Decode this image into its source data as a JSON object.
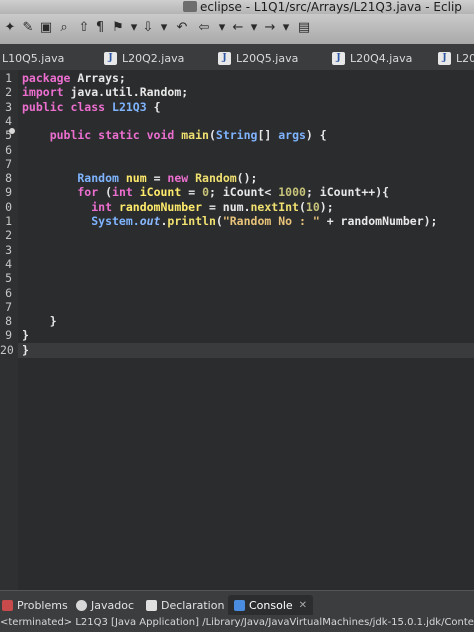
{
  "window": {
    "title": "eclipse - L1Q1/src/Arrays/L21Q3.java - Eclip"
  },
  "tabs": [
    {
      "label": "L10Q5.java"
    },
    {
      "label": "L20Q2.java"
    },
    {
      "label": "L20Q5.java"
    },
    {
      "label": "L20Q4.java"
    },
    {
      "label": "L20"
    }
  ],
  "editor": {
    "line_numbers": [
      "1",
      "2",
      "3",
      "4",
      "5",
      "6",
      "7",
      "8",
      "9",
      "0",
      "1",
      "2",
      "3",
      "4",
      "5",
      "6",
      "7",
      "8",
      "9",
      "20"
    ],
    "lines": [
      [
        {
          "t": "package ",
          "c": "kw"
        },
        {
          "t": "Arrays;",
          "c": "pl"
        }
      ],
      [
        {
          "t": "import ",
          "c": "kw"
        },
        {
          "t": "java.util.Random;",
          "c": "pl"
        }
      ],
      [
        {
          "t": "public class ",
          "c": "kw"
        },
        {
          "t": "L21Q3 ",
          "c": "ty"
        },
        {
          "t": "{",
          "c": "pl"
        }
      ],
      [],
      [
        {
          "t": "    public static void ",
          "c": "kw"
        },
        {
          "t": "main",
          "c": "fn"
        },
        {
          "t": "(",
          "c": "pl"
        },
        {
          "t": "String",
          "c": "ty"
        },
        {
          "t": "[] ",
          "c": "pl"
        },
        {
          "t": "args",
          "c": "ty"
        },
        {
          "t": ") {",
          "c": "pl"
        }
      ],
      [],
      [],
      [
        {
          "t": "        Random ",
          "c": "ty"
        },
        {
          "t": "num",
          "c": "vr"
        },
        {
          "t": " = ",
          "c": "pl"
        },
        {
          "t": "new ",
          "c": "kw"
        },
        {
          "t": "Random",
          "c": "fn"
        },
        {
          "t": "();",
          "c": "pl"
        }
      ],
      [
        {
          "t": "        for ",
          "c": "kw"
        },
        {
          "t": "(",
          "c": "pl"
        },
        {
          "t": "int ",
          "c": "kw"
        },
        {
          "t": "iCount",
          "c": "vr"
        },
        {
          "t": " = ",
          "c": "pl"
        },
        {
          "t": "0",
          "c": "num"
        },
        {
          "t": "; iCount< ",
          "c": "pl"
        },
        {
          "t": "1000",
          "c": "num"
        },
        {
          "t": "; iCount++){",
          "c": "pl"
        }
      ],
      [
        {
          "t": "          int ",
          "c": "kw"
        },
        {
          "t": "randomNumber",
          "c": "vr"
        },
        {
          "t": " = num.",
          "c": "pl"
        },
        {
          "t": "nextInt",
          "c": "fn"
        },
        {
          "t": "(",
          "c": "pl"
        },
        {
          "t": "10",
          "c": "num"
        },
        {
          "t": ");",
          "c": "pl"
        }
      ],
      [
        {
          "t": "          System.",
          "c": "ty"
        },
        {
          "t": "out",
          "c": "fld"
        },
        {
          "t": ".",
          "c": "pl"
        },
        {
          "t": "println",
          "c": "fn"
        },
        {
          "t": "(",
          "c": "pl"
        },
        {
          "t": "\"Random No : \"",
          "c": "str"
        },
        {
          "t": " + randomNumber);",
          "c": "pl"
        }
      ],
      [],
      [],
      [],
      [],
      [],
      [],
      [
        {
          "t": "    }",
          "c": "pl"
        }
      ],
      [
        {
          "t": "}",
          "c": "pl"
        }
      ],
      [
        {
          "t": "}",
          "c": "pl"
        }
      ]
    ]
  },
  "bottom_tabs": [
    {
      "label": "Problems"
    },
    {
      "label": "Javadoc"
    },
    {
      "label": "Declaration"
    },
    {
      "label": "Console"
    }
  ],
  "console": {
    "status": "<terminated> L21Q3 [Java Application] /Library/Java/JavaVirtualMachines/jdk-15.0.1.jdk/Conte"
  },
  "colors": {
    "editor_bg": "#2b2c2e",
    "keyword": "#ec6fd0",
    "type": "#7fb4ff",
    "method": "#f0e070"
  }
}
